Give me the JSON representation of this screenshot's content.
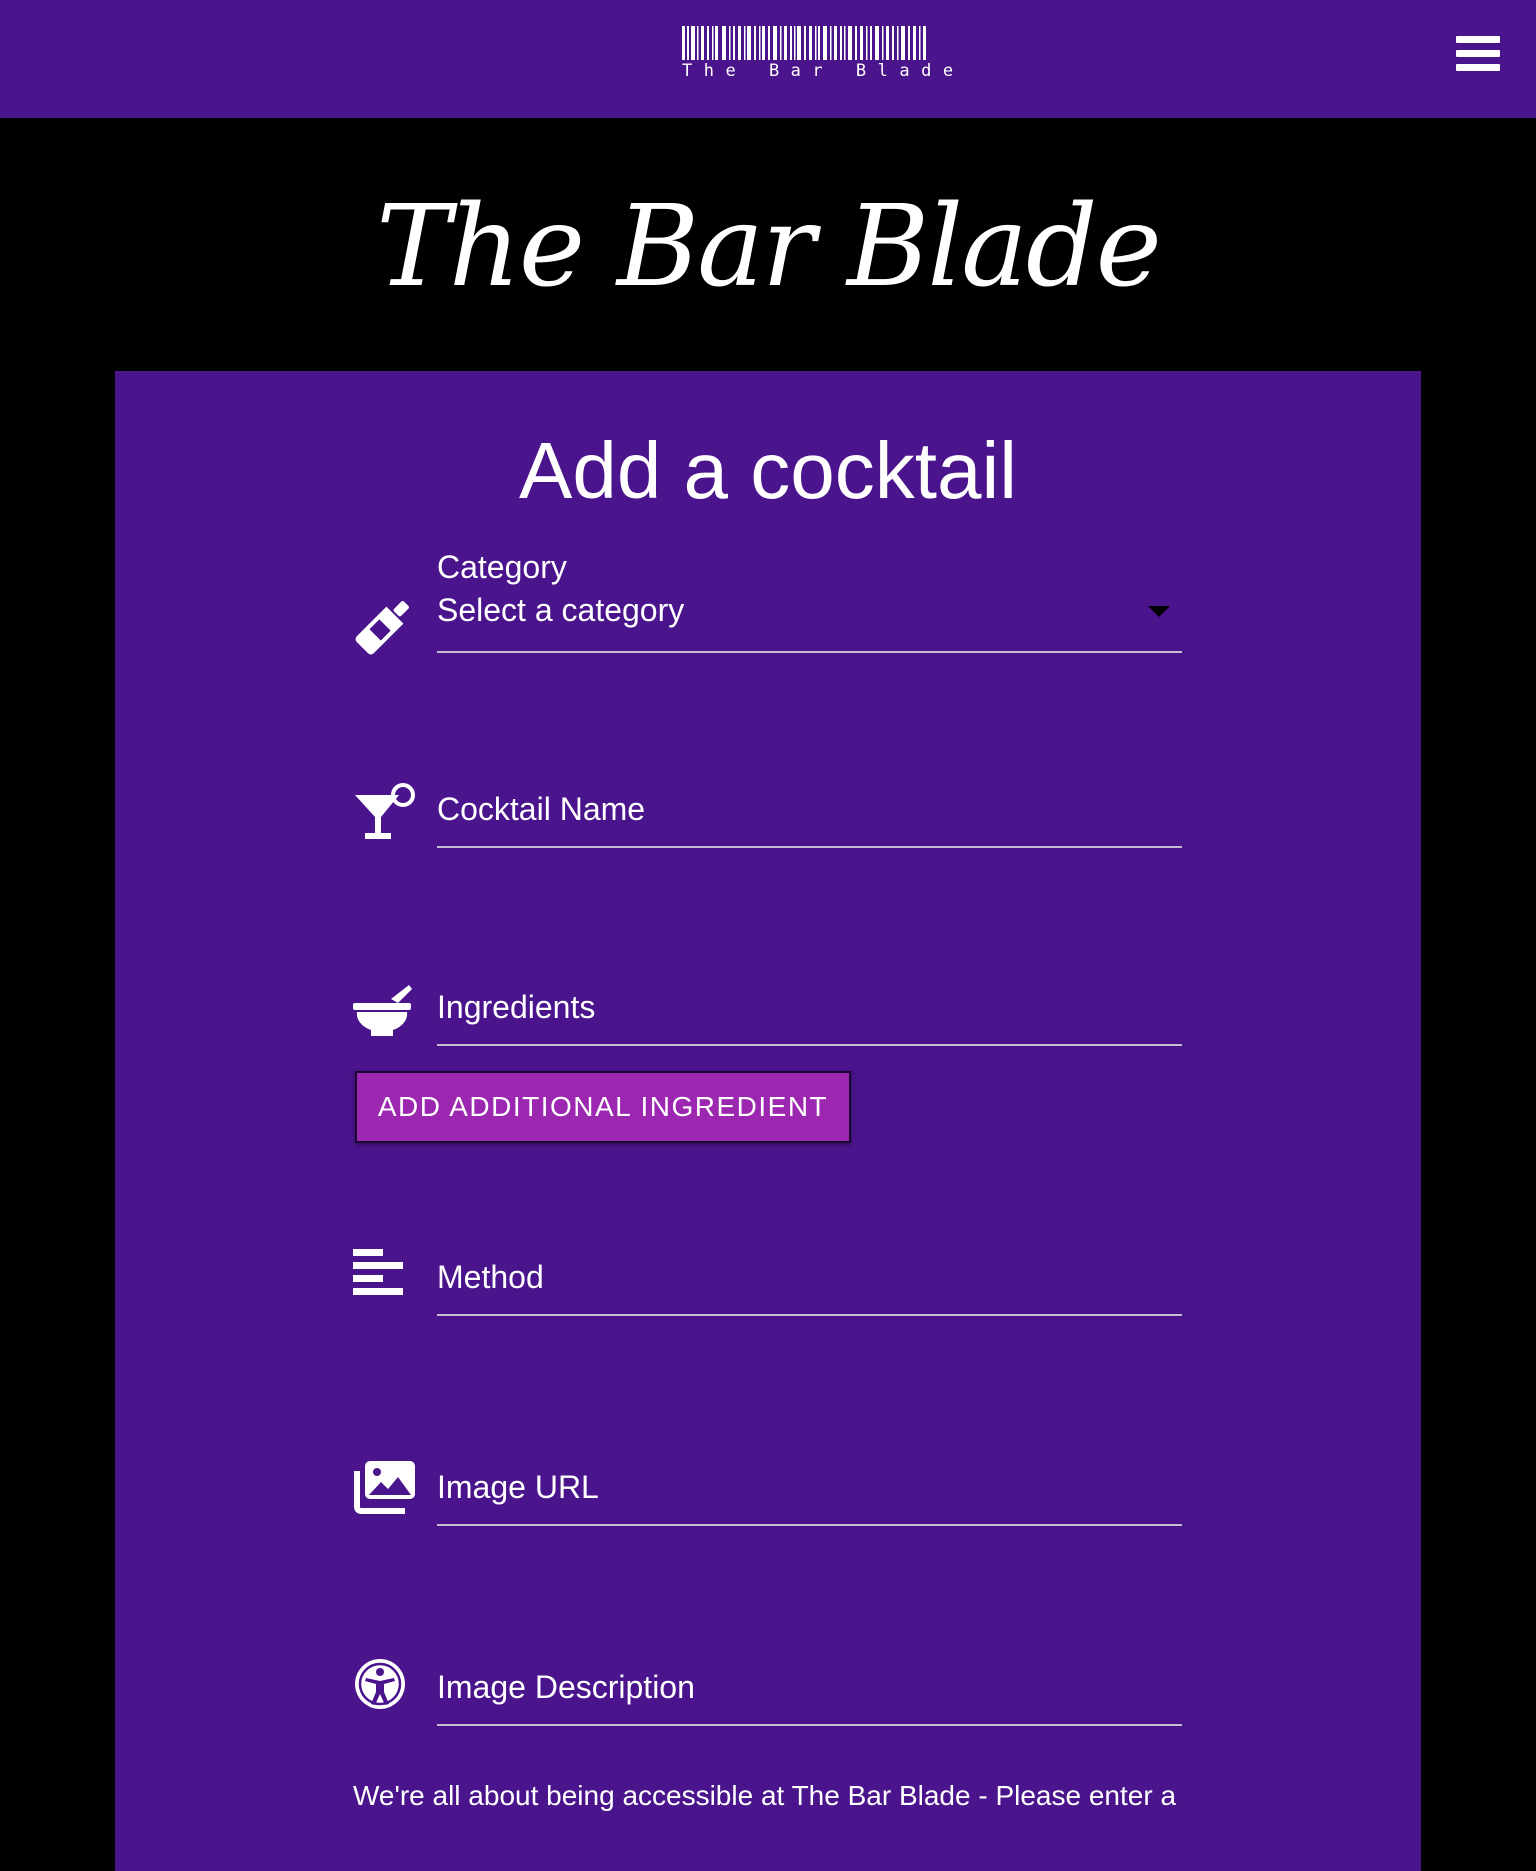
{
  "navbar": {
    "logo_text": "The Bar Blade",
    "menu_icon": "hamburger-menu-icon"
  },
  "header": {
    "site_title": "The Bar Blade"
  },
  "form": {
    "title": "Add a cocktail",
    "category": {
      "icon": "wine-bottle-icon",
      "label": "Category",
      "value": "Select a category"
    },
    "cocktail_name": {
      "icon": "cocktail-glass-icon",
      "placeholder": "Cocktail Name",
      "value": ""
    },
    "ingredients": {
      "icon": "mortar-pestle-icon",
      "placeholder": "Ingredients",
      "value": ""
    },
    "add_ingredient_label": "Add additional ingredient",
    "method": {
      "icon": "align-left-icon",
      "placeholder": "Method",
      "value": ""
    },
    "image_url": {
      "icon": "images-icon",
      "placeholder": "Image URL",
      "value": ""
    },
    "image_description": {
      "icon": "universal-access-icon",
      "placeholder": "Image Description",
      "value": ""
    },
    "accessibility_note": "We're all about being accessible at The Bar Blade - Please enter a"
  },
  "colors": {
    "brand_purple": "#4a148c",
    "button_purple": "#9c27b0",
    "background": "#000000",
    "text": "#ffffff"
  }
}
